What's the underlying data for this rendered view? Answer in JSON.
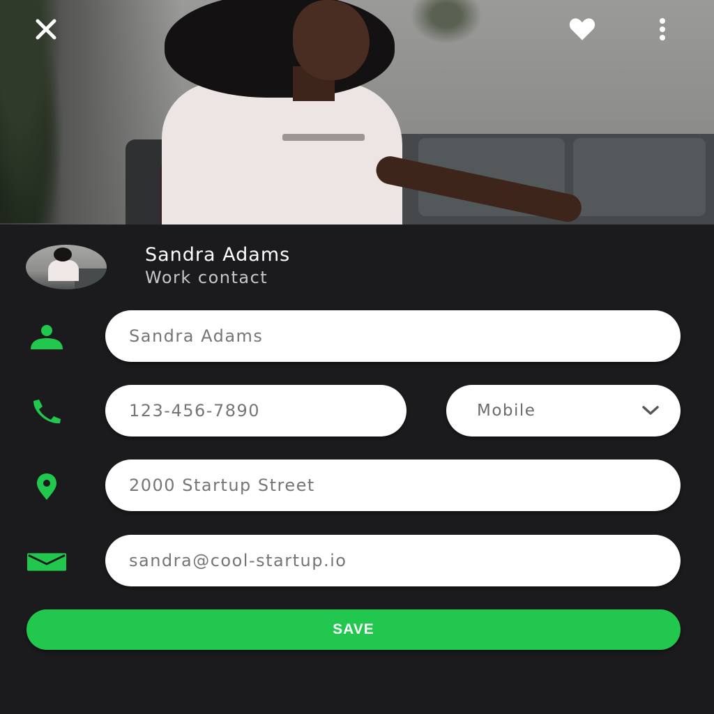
{
  "topbar": {
    "close_icon": "close-icon",
    "favorite_icon": "heart-icon",
    "more_icon": "more-vertical-icon"
  },
  "profile": {
    "name": "Sandra Adams",
    "subtitle": "Work contact"
  },
  "form": {
    "name_value": "Sandra Adams",
    "phone_value": "123-456-7890",
    "phone_type": "Mobile",
    "address_value": "2000 Startup Street",
    "email_value": "sandra@cool-startup.io",
    "save_label": "SAVE"
  },
  "colors": {
    "accent": "#22c84e",
    "background": "#1b1a1c",
    "field": "#ffffff"
  }
}
